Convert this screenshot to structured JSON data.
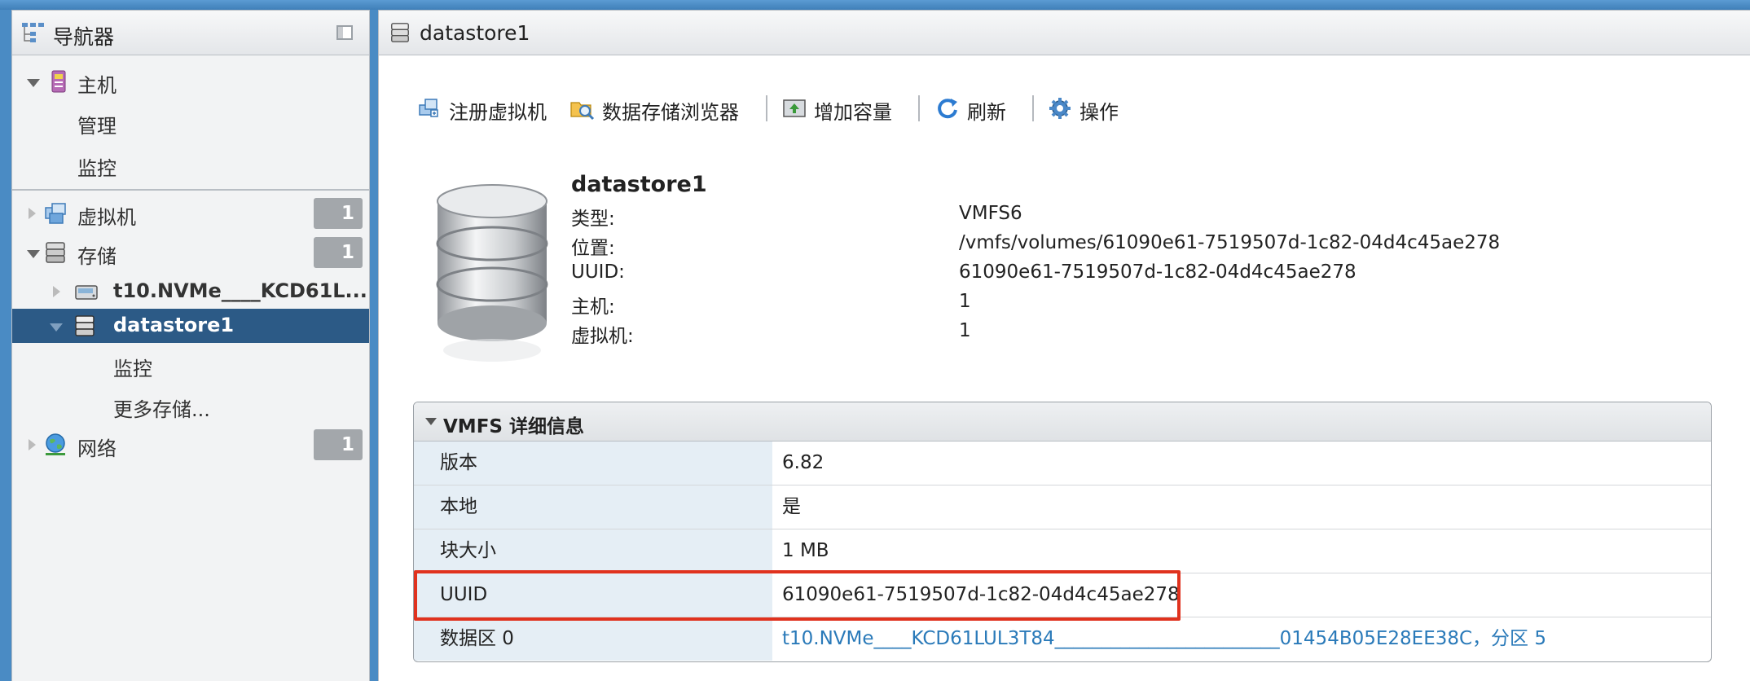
{
  "navigator": {
    "title": "导航器",
    "host": {
      "label": "主机",
      "children": [
        "管理",
        "监控"
      ]
    },
    "vms": {
      "label": "虚拟机",
      "count": "1"
    },
    "storage": {
      "label": "存储",
      "count": "1",
      "device": "t10.NVMe____KCD61L...",
      "datastore": "datastore1",
      "children": [
        "监控",
        "更多存储..."
      ]
    },
    "network": {
      "label": "网络",
      "count": "1"
    }
  },
  "main": {
    "title": "datastore1",
    "toolbar": {
      "register_vm": "注册虚拟机",
      "datastore_browser": "数据存储浏览器",
      "increase_capacity": "增加容量",
      "refresh": "刷新",
      "actions": "操作"
    },
    "summary": {
      "name": "datastore1",
      "rows": [
        {
          "key": "类型:",
          "value": "VMFS6"
        },
        {
          "key": "位置:",
          "value": "/vmfs/volumes/61090e61-7519507d-1c82-04d4c45ae278"
        },
        {
          "key": "UUID:",
          "value": "61090e61-7519507d-1c82-04d4c45ae278"
        },
        {
          "key": "主机:",
          "value": "1"
        },
        {
          "key": "虚拟机:",
          "value": "1"
        }
      ]
    },
    "vmfs_details": {
      "title": "VMFS 详细信息",
      "rows": [
        {
          "key": "版本",
          "value": "6.82"
        },
        {
          "key": "本地",
          "value": "是"
        },
        {
          "key": "块大小",
          "value": "1 MB"
        },
        {
          "key": "UUID",
          "value": "61090e61-7519507d-1c82-04d4c45ae278"
        },
        {
          "key": "数据区 0",
          "value": "t10.NVMe____KCD61LUL3T84________________________01454B05E28EE38C，分区 5"
        }
      ]
    }
  },
  "colors": {
    "selected_bg": "#2c5a86",
    "highlight_border": "#e0321e",
    "link": "#2a7ab9"
  }
}
